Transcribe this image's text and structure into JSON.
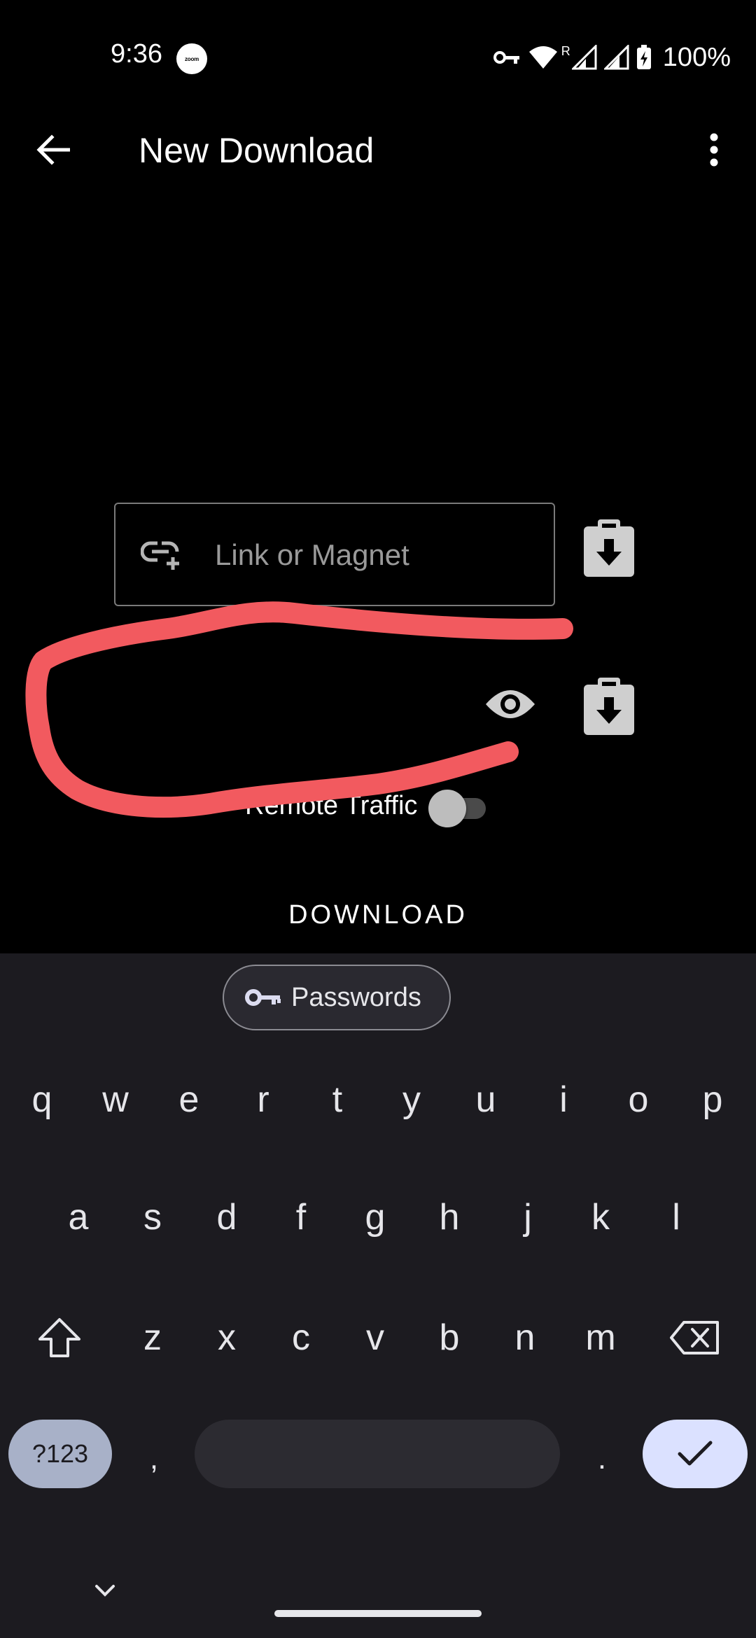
{
  "status_bar": {
    "time": "9:36",
    "zoom_badge": "zoom",
    "roaming": "R",
    "battery": "100%"
  },
  "app_bar": {
    "title": "New Download",
    "back_icon": "arrow-back-icon",
    "menu_icon": "more-vert-icon"
  },
  "form": {
    "link_placeholder": "Link or Magnet",
    "remote_traffic_label": "Remote Traffic",
    "remote_traffic_on": false,
    "download_label": "DOWNLOAD"
  },
  "keyboard": {
    "suggestion_chip": "Passwords",
    "row1": [
      "q",
      "w",
      "e",
      "r",
      "t",
      "y",
      "u",
      "i",
      "o",
      "p"
    ],
    "row2": [
      "a",
      "s",
      "d",
      "f",
      "g",
      "h",
      "j",
      "k",
      "l"
    ],
    "row3": [
      "z",
      "x",
      "c",
      "v",
      "b",
      "n",
      "m"
    ],
    "symbols_key": "?123",
    "comma_key": ",",
    "period_key": "."
  },
  "annotation": {
    "color": "#f25a5f"
  }
}
